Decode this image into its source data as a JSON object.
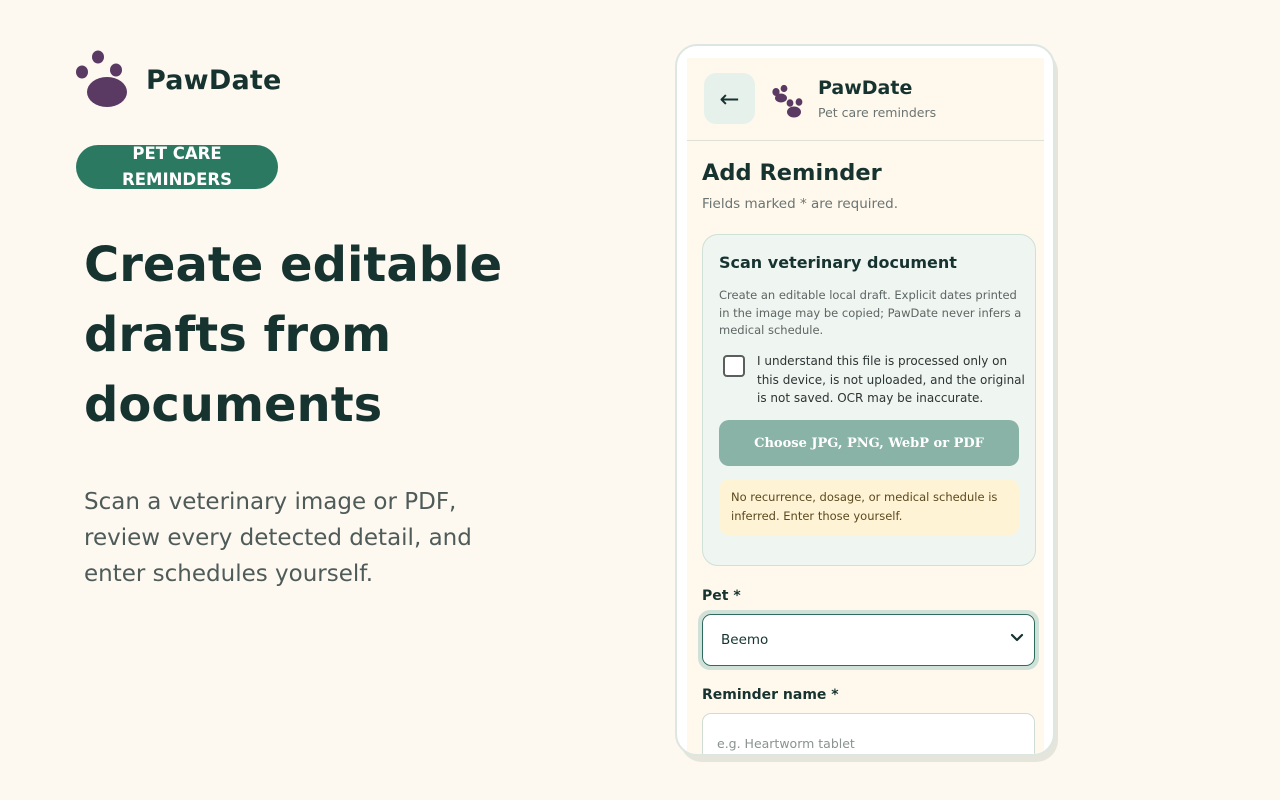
{
  "brand": {
    "name": "PawDate",
    "accent_color": "#5a3a63",
    "icon": "paw-icon"
  },
  "hero": {
    "badge": "PET CARE REMINDERS",
    "headline": "Create editable drafts from documents",
    "subtext": "Scan a veterinary image or PDF, review every detected detail, and enter schedules yourself."
  },
  "app": {
    "header": {
      "back_glyph": "←",
      "title": "PawDate",
      "subtitle": "Pet care reminders",
      "icon": "paw-icon"
    },
    "form": {
      "title": "Add Reminder",
      "hint": "Fields marked * are required.",
      "scan": {
        "title": "Scan veterinary document",
        "description": "Create an editable local draft. Explicit dates printed in the image may be copied; PawDate never infers a medical schedule.",
        "consent": "I understand this file is processed only on this device, is not uploaded, and the original is not saved. OCR may be inaccurate.",
        "consent_checked": false,
        "button": "Choose JPG, PNG, WebP or PDF",
        "notice": "No recurrence, dosage, or medical schedule is inferred. Enter those yourself."
      },
      "pet": {
        "label": "Pet *",
        "value": "Beemo"
      },
      "reminder_name": {
        "label": "Reminder name *",
        "placeholder": "e.g. Heartworm tablet",
        "value": ""
      }
    }
  },
  "colors": {
    "background": "#fdf9f1",
    "badge": "#2c7962",
    "text": "#173330",
    "choose_button": "#88b3a6",
    "notice": "#fff3d6"
  }
}
